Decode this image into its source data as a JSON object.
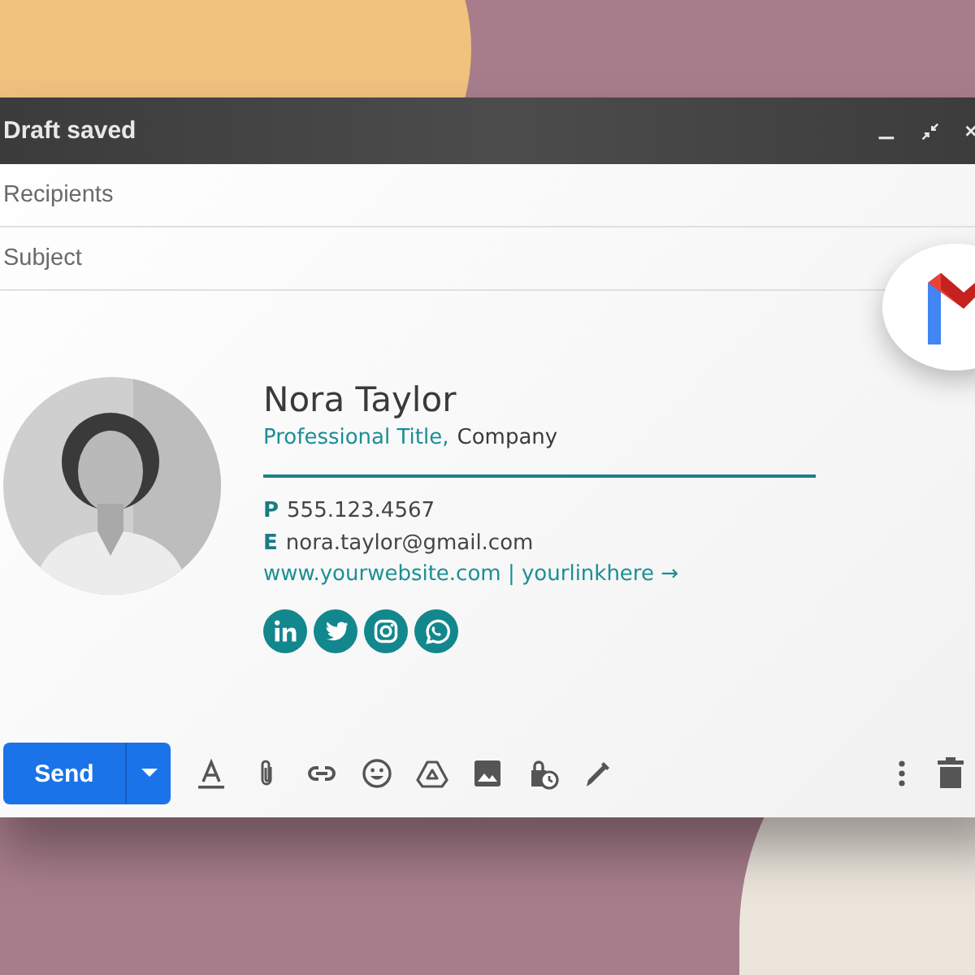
{
  "window": {
    "title": "Draft saved"
  },
  "fields": [
    {
      "placeholder": "Recipients"
    },
    {
      "placeholder": "Subject"
    }
  ],
  "signature": {
    "name": "Nora Taylor",
    "title": "Professional Title,",
    "company": "Company",
    "contacts": [
      {
        "label": "P",
        "value": "555.123.4567"
      },
      {
        "label": "E",
        "value": "nora.taylor@gmail.com"
      }
    ],
    "links": "www.yourwebsite.com | yourlinkhere →"
  },
  "toolbar": {
    "send": "Send"
  }
}
